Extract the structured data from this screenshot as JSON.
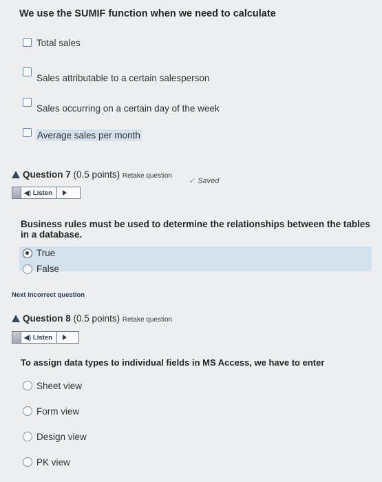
{
  "q6": {
    "text": "We use the SUMIF function when we need to calculate",
    "options": [
      "Total sales",
      "Sales attributable to a certain salesperson",
      "Sales occurring on a certain day of the week",
      "Average sales per month"
    ]
  },
  "q7": {
    "label": "Question 7",
    "points": "(0.5 points)",
    "retake": "Retake question",
    "saved": "Saved",
    "listen": "Listen",
    "text": "Business rules must be used to determine the relationships between the tables in a database.",
    "options": [
      "True",
      "False"
    ],
    "selected": "True"
  },
  "next_incorrect": "Next incorrect question",
  "q8": {
    "label": "Question 8",
    "points": "(0.5 points)",
    "retake": "Retake question",
    "listen": "Listen",
    "text": "To assign data types to individual fields in MS Access, we have to enter",
    "options": [
      "Sheet view",
      "Form view",
      "Design view",
      "PK view"
    ]
  }
}
